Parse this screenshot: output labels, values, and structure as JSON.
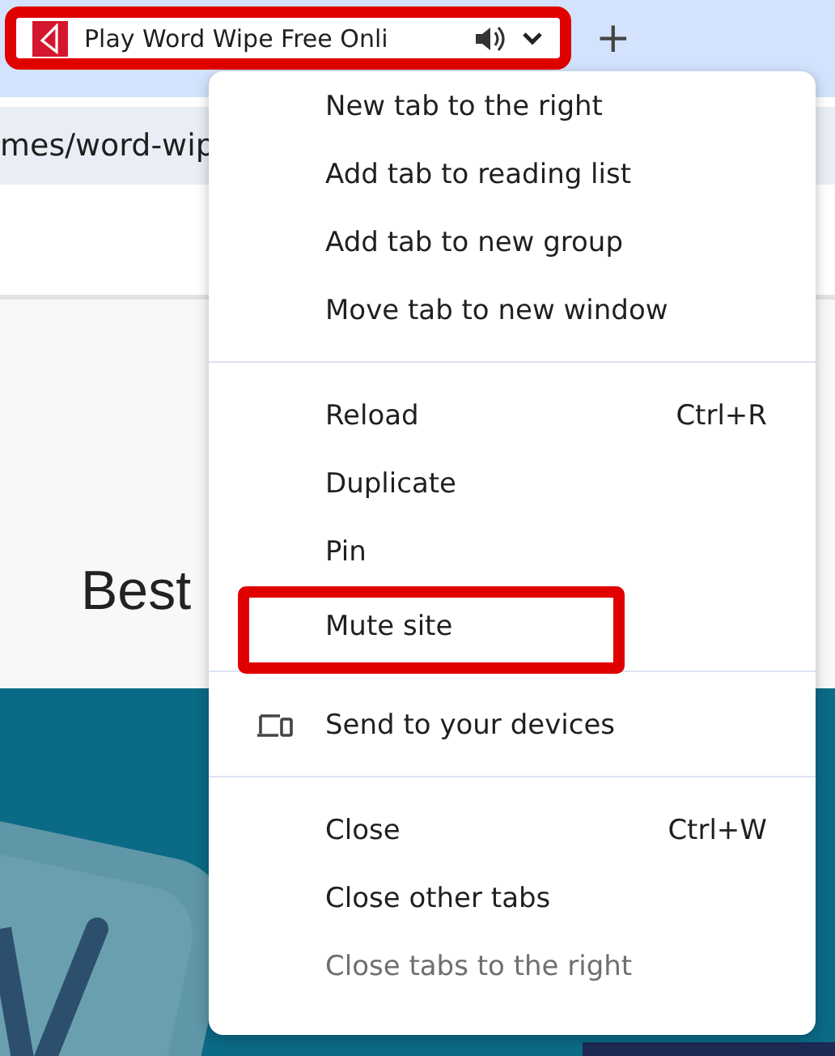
{
  "tab": {
    "title": "Play Word Wipe Free Onli",
    "highlighted": true
  },
  "new_tab_button": "+",
  "address_bar": {
    "url": "mes/word-wip"
  },
  "page": {
    "heading": "Best"
  },
  "context_menu": {
    "sections": [
      {
        "items": [
          {
            "label": "New tab to the right",
            "disabled": false,
            "highlighted": false
          },
          {
            "label": "Add tab to reading list",
            "disabled": false,
            "highlighted": false
          },
          {
            "label": "Add tab to new group",
            "disabled": false,
            "highlighted": false
          },
          {
            "label": "Move tab to new window",
            "disabled": false,
            "highlighted": false
          }
        ]
      },
      {
        "items": [
          {
            "label": "Reload",
            "shortcut": "Ctrl+R",
            "disabled": false,
            "highlighted": false
          },
          {
            "label": "Duplicate",
            "disabled": false,
            "highlighted": false
          },
          {
            "label": "Pin",
            "disabled": false,
            "highlighted": false
          },
          {
            "label": "Mute site",
            "disabled": false,
            "highlighted": true
          }
        ]
      },
      {
        "items": [
          {
            "label": "Send to your devices",
            "kind": "send",
            "disabled": false,
            "highlighted": false
          }
        ]
      },
      {
        "items": [
          {
            "label": "Close",
            "shortcut": "Ctrl+W",
            "disabled": false,
            "highlighted": false
          },
          {
            "label": "Close other tabs",
            "disabled": false,
            "highlighted": false
          },
          {
            "label": "Close tabs to the right",
            "disabled": true,
            "highlighted": false
          }
        ]
      }
    ]
  }
}
